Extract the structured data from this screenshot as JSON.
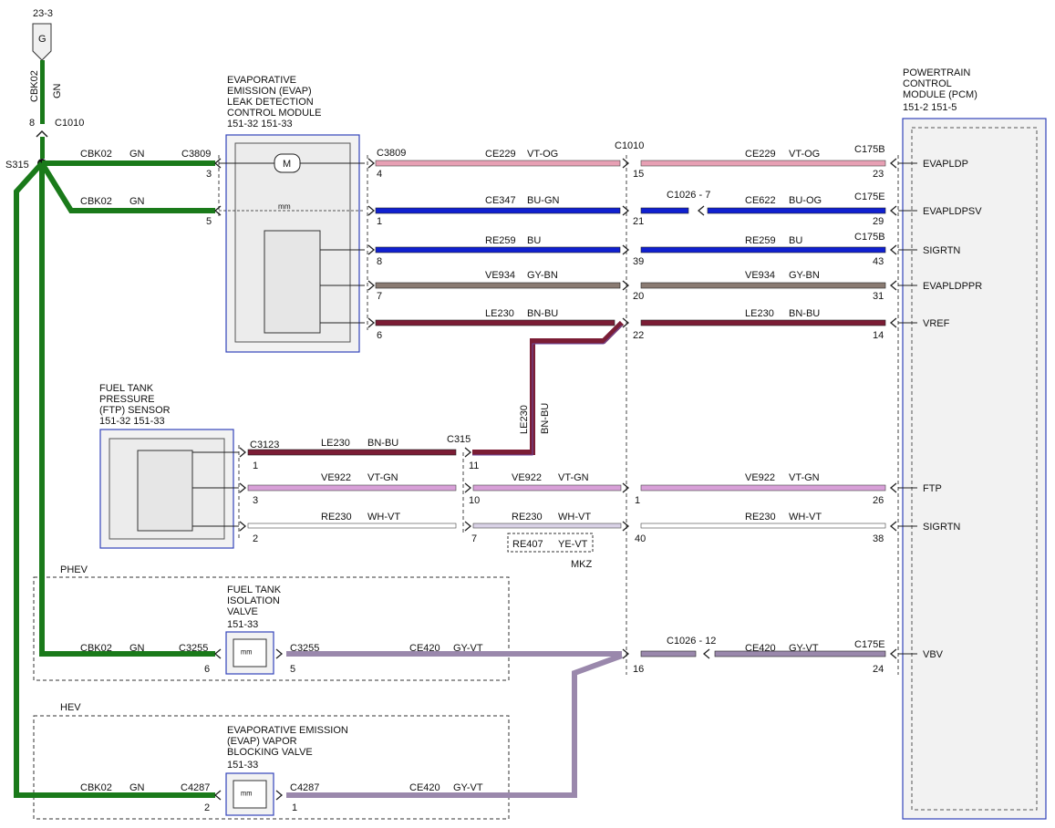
{
  "ground": {
    "ref": "23-3",
    "letter": "G",
    "wire": "CBK02",
    "color": "GN",
    "pin": "8",
    "connector": "C1010",
    "splice": "S315"
  },
  "modules": {
    "evap_ldcm": {
      "lines": [
        "EVAPORATIVE",
        "EMISSION (EVAP)",
        "LEAK DETECTION",
        "CONTROL MODULE",
        "151-32  151-33"
      ]
    },
    "ftp": {
      "lines": [
        "FUEL TANK",
        "PRESSURE",
        "(FTP) SENSOR",
        "151-32  151-33"
      ]
    },
    "pcm": {
      "lines": [
        "POWERTRAIN",
        "CONTROL",
        "MODULE (PCM)",
        "151-2  151-5"
      ]
    },
    "ftiv": {
      "lines": [
        "FUEL TANK",
        "ISOLATION",
        "VALVE",
        "151-33"
      ]
    },
    "vbv": {
      "lines": [
        "EVAPORATIVE EMISSION",
        "(EVAP) VAPOR",
        "BLOCKING VALVE",
        "151-33"
      ]
    }
  },
  "regions": {
    "phev": "PHEV",
    "hev": "HEV"
  },
  "pcm_pins": [
    "EVAPLDP",
    "EVAPLDPSV",
    "SIGRTN",
    "EVAPLDPPR",
    "VREF",
    "FTP",
    "SIGRTN",
    "VBV"
  ],
  "texts": {
    "cbk02": "CBK02",
    "gn": "GN",
    "c3809": "C3809",
    "c1010": "C1010",
    "c175b": "C175B",
    "c175e": "C175E",
    "c1026_7": "C1026  -  7",
    "c1026_12": "C1026  -  12",
    "c3123": "C3123",
    "c315": "C315",
    "c3255": "C3255",
    "c4287": "C4287",
    "ce229": "CE229",
    "vt_og": "VT-OG",
    "ce347": "CE347",
    "bu_gn": "BU-GN",
    "ce622": "CE622",
    "bu_og": "BU-OG",
    "re259": "RE259",
    "bu": "BU",
    "ve934": "VE934",
    "gy_bn": "GY-BN",
    "le230": "LE230",
    "bn_bu": "BN-BU",
    "ve922": "VE922",
    "vt_gn": "VT-GN",
    "re230": "RE230",
    "wh_vt": "WH-VT",
    "re407": "RE407",
    "ye_vt": "YE-VT",
    "mkz": "MKZ",
    "ce420": "CE420",
    "gy_vt": "GY-VT"
  },
  "pins": {
    "p3": "3",
    "p5": "5",
    "p4": "4",
    "p1": "1",
    "p8": "8",
    "p7": "7",
    "p6": "6",
    "p15": "15",
    "p21": "21",
    "p39": "39",
    "p20": "20",
    "p22": "22",
    "p23": "23",
    "p29": "29",
    "p43": "43",
    "p31": "31",
    "p14": "14",
    "f1": "1",
    "f3": "3",
    "f2": "2",
    "p11": "11",
    "p10": "10",
    "q7": "7",
    "q1": "1",
    "p40": "40",
    "p26": "26",
    "p38": "38",
    "v6": "6",
    "v5": "5",
    "v16": "16",
    "v24": "24",
    "h2": "2",
    "h1": "1"
  },
  "wire_colors": {
    "green": "#1a7a1a",
    "pink": "#e7a0b4",
    "blue": "#1020d0",
    "gray_brown": "#8a7b72",
    "maroon": "#7b1d35",
    "violet_green": "#d8a0d8",
    "white_violet": "#d9d2e6",
    "gray_violet": "#9a88ac"
  }
}
